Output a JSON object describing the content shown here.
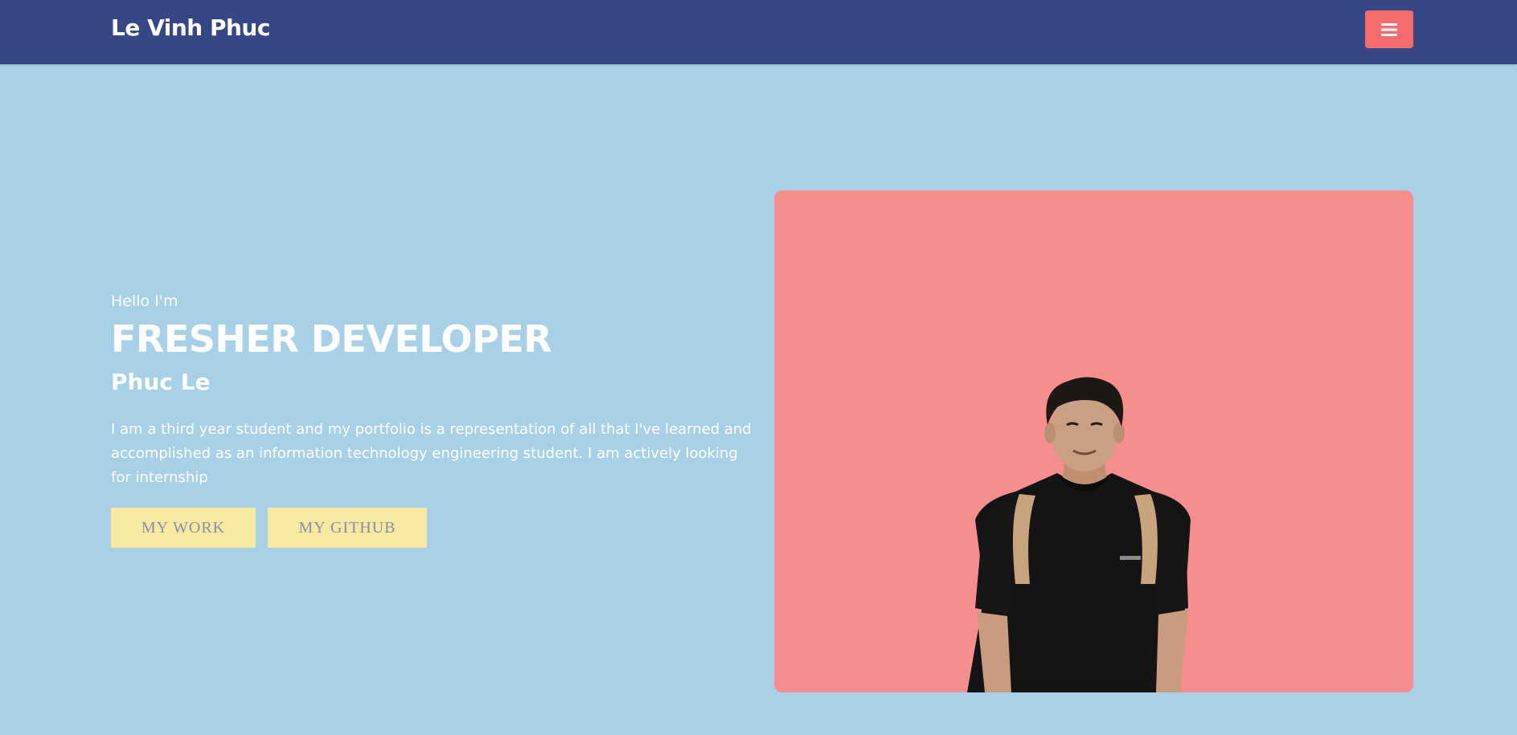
{
  "nav": {
    "brand": "Le Vinh Phuc",
    "menu_icon": "hamburger-icon"
  },
  "hero": {
    "greeting": "Hello I'm",
    "role": "FRESHER DEVELOPER",
    "name": "Phuc Le",
    "bio": "I am a third year student and my portfolio is a representation of all that I've learned and accomplished as an information technology engineering student. I am actively looking for internship",
    "buttons": {
      "work": "MY WORK",
      "github": "MY GITHUB"
    }
  },
  "colors": {
    "navbar": "#374785",
    "background": "#a8d0e6",
    "accent": "#f76c6c",
    "photo_bg": "#f78e8e",
    "button_bg": "#f8e9a1"
  }
}
